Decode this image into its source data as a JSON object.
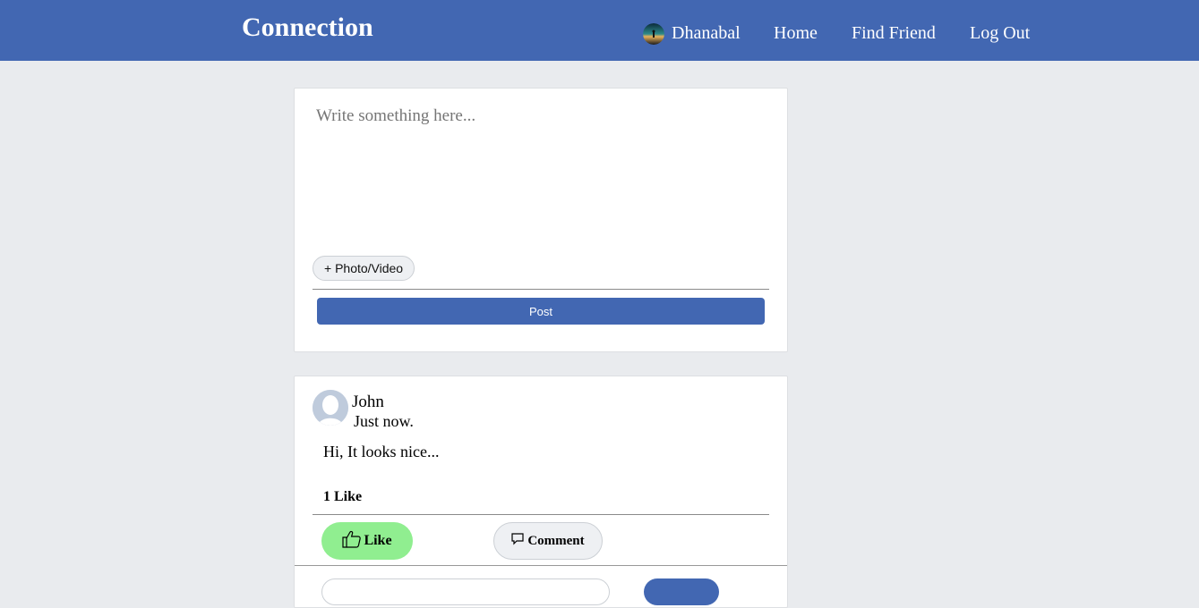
{
  "header": {
    "brand": "Connection",
    "user_name": "Dhanabal",
    "nav": {
      "home": "Home",
      "find_friend": "Find Friend",
      "logout": "Log Out"
    }
  },
  "composer": {
    "placeholder": "Write something here...",
    "photo_video_label": "+ Photo/Video",
    "post_label": "Post"
  },
  "post": {
    "author": "John",
    "time": "Just now.",
    "text": "Hi, It looks nice...",
    "like_count": "1 Like",
    "like_label": "Like",
    "comment_label": "Comment",
    "like_active_color": "#90ee90"
  },
  "colors": {
    "brand": "#4267b2",
    "background": "#e9ebee"
  }
}
